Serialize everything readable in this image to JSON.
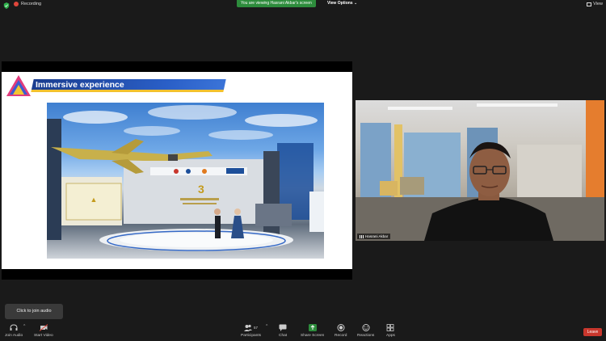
{
  "topbar": {
    "recording_label": "Recording",
    "share_banner": "You are viewing Hasrani Akbar's screen",
    "view_options_label": "View Options",
    "view_label": "View"
  },
  "slide": {
    "title": "Immersive experience"
  },
  "video": {
    "participant_name": "Hasrani Akbar"
  },
  "tooltip": {
    "text": "Click to join audio"
  },
  "toolbar": {
    "join_audio": "Join Audio",
    "start_video": "Start Video",
    "participants": "Participants",
    "participants_count": "57",
    "chat": "Chat",
    "share_screen": "Share Screen",
    "record": "Record",
    "reactions": "Reactions",
    "apps": "Apps",
    "leave": "Leave"
  },
  "colors": {
    "share_banner": "#2d8c3c",
    "share_screen_icon": "#2d8c3c",
    "leave_button": "#c8372d",
    "recording_dot": "#e0463b"
  }
}
